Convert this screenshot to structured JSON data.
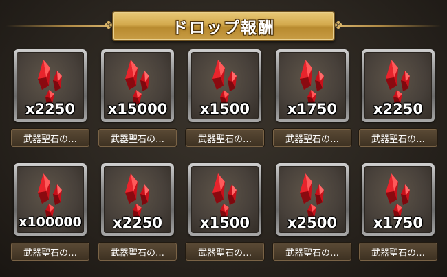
{
  "header": {
    "title": "ドロップ報酬"
  },
  "rewards": [
    {
      "quantity": "x2250",
      "name": "武器聖石の…",
      "icon": "red-crystal-icon"
    },
    {
      "quantity": "x15000",
      "name": "武器聖石の…",
      "icon": "red-crystal-icon"
    },
    {
      "quantity": "x1500",
      "name": "武器聖石の…",
      "icon": "red-crystal-icon"
    },
    {
      "quantity": "x1750",
      "name": "武器聖石の…",
      "icon": "red-crystal-icon"
    },
    {
      "quantity": "x2250",
      "name": "武器聖石の…",
      "icon": "red-crystal-icon"
    },
    {
      "quantity": "x100000",
      "name": "武器聖石の…",
      "icon": "red-crystal-icon"
    },
    {
      "quantity": "x2250",
      "name": "武器聖石の…",
      "icon": "red-crystal-icon"
    },
    {
      "quantity": "x1500",
      "name": "武器聖石の…",
      "icon": "red-crystal-icon"
    },
    {
      "quantity": "x2500",
      "name": "武器聖石の…",
      "icon": "red-crystal-icon"
    },
    {
      "quantity": "x1750",
      "name": "武器聖石の…",
      "icon": "red-crystal-icon"
    }
  ],
  "colors": {
    "gold": "#d3a94d",
    "crystal_red": "#d0141c",
    "background": "#2a251f"
  }
}
